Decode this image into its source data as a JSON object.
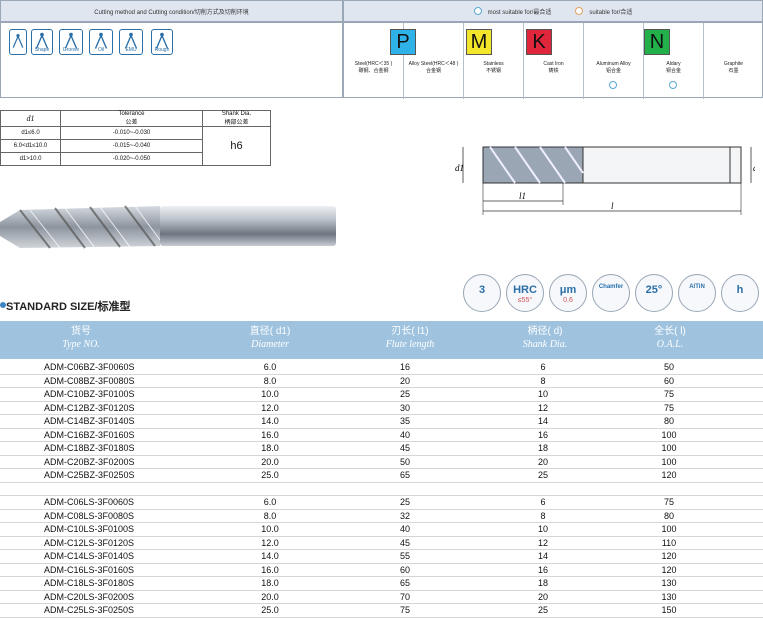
{
  "header": {
    "cutting_method": "Cutting method and Cutting condition/切削方式及切削环境",
    "most_suitable": "most suitable for/最合适",
    "suitable": "suitable for/合适"
  },
  "condition_icons": [
    {
      "name": "plunge-icon"
    },
    {
      "name": "shape-icon",
      "label": "Shape"
    },
    {
      "name": "groove-icon",
      "label": "Groove"
    },
    {
      "name": "oil-icon",
      "label": "Oil"
    },
    {
      "name": "emu-icon",
      "label": "EMU"
    },
    {
      "name": "rough-icon",
      "label": "Rough"
    }
  ],
  "materials": [
    {
      "letter": "P",
      "color": "#2fb2e8",
      "label": "Steel(HRC＜35 )\n碳钢、合金钢",
      "mark": false
    },
    {
      "letter": "",
      "color": "",
      "label": "Alloy Steel(HRC＜48 )\n合金钢",
      "mark": false
    },
    {
      "letter": "M",
      "color": "#f2e52a",
      "label": "Stainless\n不锈钢",
      "mark": false
    },
    {
      "letter": "K",
      "color": "#e0263a",
      "label": "Cast Iron\n铸铁",
      "mark": false
    },
    {
      "letter": "",
      "color": "",
      "label": "Aluminum Alloy\n铝合金",
      "mark": true
    },
    {
      "letter": "N",
      "color": "#22b04b",
      "label": "Aldary\n铜合金",
      "mark": true
    },
    {
      "letter": "",
      "color": "",
      "label": "Graphite\n石墨",
      "mark": false
    }
  ],
  "tolerance": {
    "col_d1": "d1",
    "col_tol": "Tolerance",
    "col_tol_cn": "公差",
    "col_shank": "Shank Dia.",
    "col_shank_cn": "柄部公差",
    "rows": [
      {
        "range": "d1≤6.0",
        "tol": "-0.010~-0.030"
      },
      {
        "range": "6.0<d1≤10.0",
        "tol": "-0.015~-0.040"
      },
      {
        "range": "d1>10.0",
        "tol": "-0.020~-0.050"
      }
    ],
    "shank": "h6"
  },
  "drawing": {
    "d1": "d1",
    "l1": "l1",
    "d": "d",
    "l": "l"
  },
  "features": [
    {
      "name": "flutes-icon",
      "text": "3"
    },
    {
      "name": "hrc-icon",
      "text": "HRC",
      "sub": "≤55°"
    },
    {
      "name": "micro-icon",
      "text": "μm",
      "sub": "0.6"
    },
    {
      "name": "chamfer-icon",
      "text": "Chamfer"
    },
    {
      "name": "helix-icon",
      "text": "25°"
    },
    {
      "name": "coating-icon",
      "text": "AlTiN"
    },
    {
      "name": "h-tolerance-icon",
      "text": "h"
    }
  ],
  "standard": {
    "title": "STANDARD SIZE/标准型",
    "columns": [
      {
        "cn": "货号",
        "en": "Type NO."
      },
      {
        "cn": "直径( d1)",
        "en": "Diameter"
      },
      {
        "cn": "刃长( l1)",
        "en": "Flute length"
      },
      {
        "cn": "柄径( d)",
        "en": "Shank Dia."
      },
      {
        "cn": "全长( l)",
        "en": "O.A.L."
      }
    ],
    "rows": [
      [
        "ADM-C06BZ-3F0060S",
        "6.0",
        "16",
        "6",
        "50"
      ],
      [
        "ADM-C08BZ-3F0080S",
        "8.0",
        "20",
        "8",
        "60"
      ],
      [
        "ADM-C10BZ-3F0100S",
        "10.0",
        "25",
        "10",
        "75"
      ],
      [
        "ADM-C12BZ-3F0120S",
        "12.0",
        "30",
        "12",
        "75"
      ],
      [
        "ADM-C14BZ-3F0140S",
        "14.0",
        "35",
        "14",
        "80"
      ],
      [
        "ADM-C16BZ-3F0160S",
        "16.0",
        "40",
        "16",
        "100"
      ],
      [
        "ADM-C18BZ-3F0180S",
        "18.0",
        "45",
        "18",
        "100"
      ],
      [
        "ADM-C20BZ-3F0200S",
        "20.0",
        "50",
        "20",
        "100"
      ],
      [
        "ADM-C25BZ-3F0250S",
        "25.0",
        "65",
        "25",
        "120"
      ],
      [
        "",
        "",
        "",
        "",
        ""
      ],
      [
        "ADM-C06LS-3F0060S",
        "6.0",
        "25",
        "6",
        "75"
      ],
      [
        "ADM-C08LS-3F0080S",
        "8.0",
        "32",
        "8",
        "80"
      ],
      [
        "ADM-C10LS-3F0100S",
        "10.0",
        "40",
        "10",
        "100"
      ],
      [
        "ADM-C12LS-3F0120S",
        "12.0",
        "45",
        "12",
        "110"
      ],
      [
        "ADM-C14LS-3F0140S",
        "14.0",
        "55",
        "14",
        "120"
      ],
      [
        "ADM-C16LS-3F0160S",
        "16.0",
        "60",
        "16",
        "120"
      ],
      [
        "ADM-C18LS-3F0180S",
        "18.0",
        "65",
        "18",
        "130"
      ],
      [
        "ADM-C20LS-3F0200S",
        "20.0",
        "70",
        "20",
        "130"
      ],
      [
        "ADM-C25LS-3F0250S",
        "25.0",
        "75",
        "25",
        "150"
      ]
    ]
  }
}
